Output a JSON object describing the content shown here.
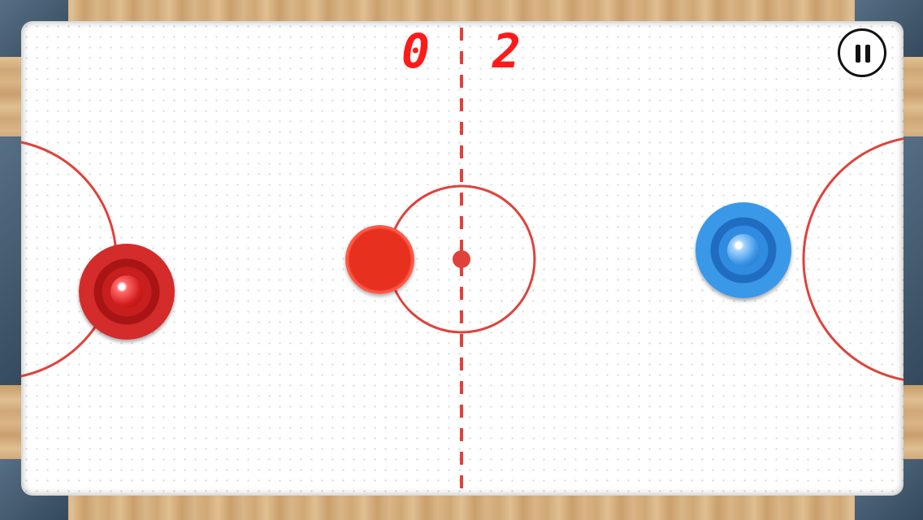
{
  "scoreboard": {
    "left_score": "0",
    "right_score": "2"
  },
  "controls": {
    "pause_icon": "pause-icon"
  },
  "players": {
    "left_mallet_color": "#d42b2b",
    "right_mallet_color": "#3a98e8",
    "puck_color": "#e8301f"
  },
  "colors": {
    "line": "#e0423a",
    "score": "#ff1a1a",
    "frame_metal": "#3e5468"
  }
}
